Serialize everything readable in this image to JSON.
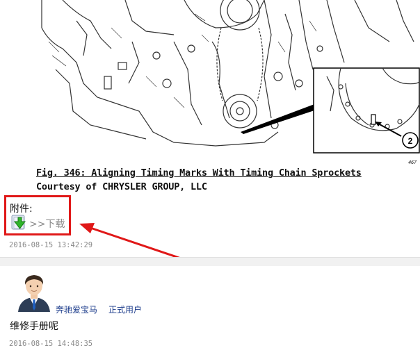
{
  "post1": {
    "figure_caption": "Fig. 346: Aligning Timing Marks With Timing Chain Sprockets",
    "figure_credit": "Courtesy of CHRYSLER GROUP, LLC",
    "callout_number": "2",
    "figure_code": "467",
    "attachment_label": "附件:",
    "download_link": ">>下载",
    "download_icon": "green-down-arrow-icon",
    "timestamp": "2016-08-15 13:42:29"
  },
  "post2": {
    "user_name": "奔驰爱宝马",
    "user_role": "正式用户",
    "reply_text": "维修手册呢",
    "timestamp": "2016-08-15 14:48:35"
  },
  "colors": {
    "annotation_red": "#e01818",
    "link_blue": "#1a3a8a",
    "timestamp_gray": "#888888"
  }
}
